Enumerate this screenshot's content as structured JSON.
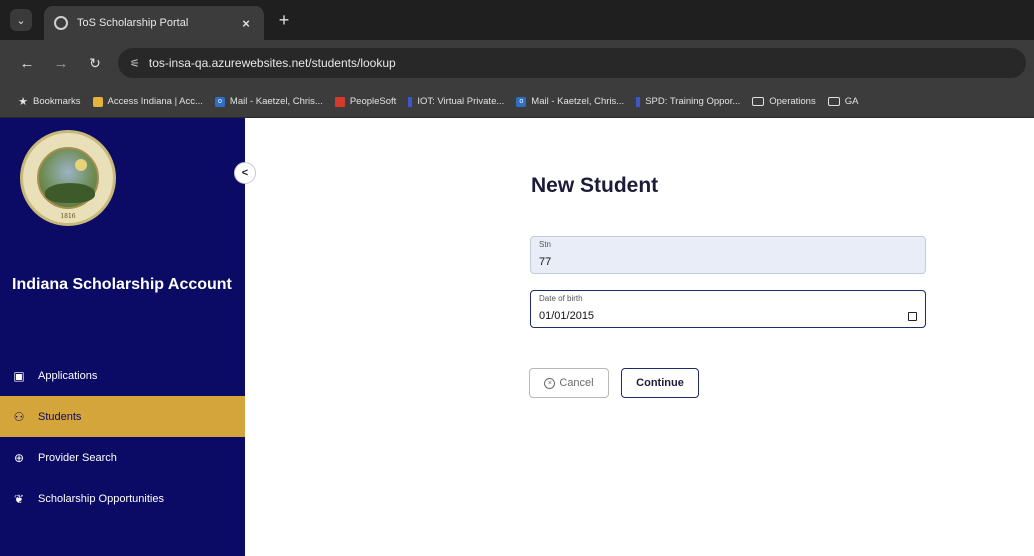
{
  "browser": {
    "tab_title": "ToS Scholarship Portal",
    "tab_close": "×",
    "new_tab": "+",
    "url": "tos-insa-qa.azurewebsites.net/students/lookup",
    "bookmarks": [
      {
        "label": "Bookmarks",
        "icon": "star-icon"
      },
      {
        "label": "Access Indiana | Acc...",
        "icon": "lock-icon"
      },
      {
        "label": "Mail - Kaetzel, Chris...",
        "icon": "mail-icon"
      },
      {
        "label": "PeopleSoft",
        "icon": "peoplesoft-icon"
      },
      {
        "label": "IOT: Virtual Private...",
        "icon": "flag-icon"
      },
      {
        "label": "Mail - Kaetzel, Chris...",
        "icon": "mail-icon"
      },
      {
        "label": "SPD: Training Oppor...",
        "icon": "flag-icon"
      },
      {
        "label": "Operations",
        "icon": "folder-icon"
      },
      {
        "label": "GA",
        "icon": "folder-icon"
      }
    ]
  },
  "sidebar": {
    "app_title": "Indiana Scholarship Account",
    "seal_year": "1816",
    "items": [
      {
        "label": "Applications",
        "icon": "clipboard-icon",
        "active": false
      },
      {
        "label": "Students",
        "icon": "people-icon",
        "active": true
      },
      {
        "label": "Provider Search",
        "icon": "search-icon",
        "active": false
      },
      {
        "label": "Scholarship Opportunities",
        "icon": "gift-icon",
        "active": false
      }
    ]
  },
  "main": {
    "title": "New Student",
    "stn_label": "Stn",
    "stn_value": "77",
    "dob_label": "Date of birth",
    "dob_value": "01/01/2015",
    "cancel_label": "Cancel",
    "continue_label": "Continue"
  },
  "colors": {
    "sidebar_bg": "#0b0b66",
    "active_item_bg": "#d3a53a",
    "accent_border": "#1f2a6a"
  }
}
